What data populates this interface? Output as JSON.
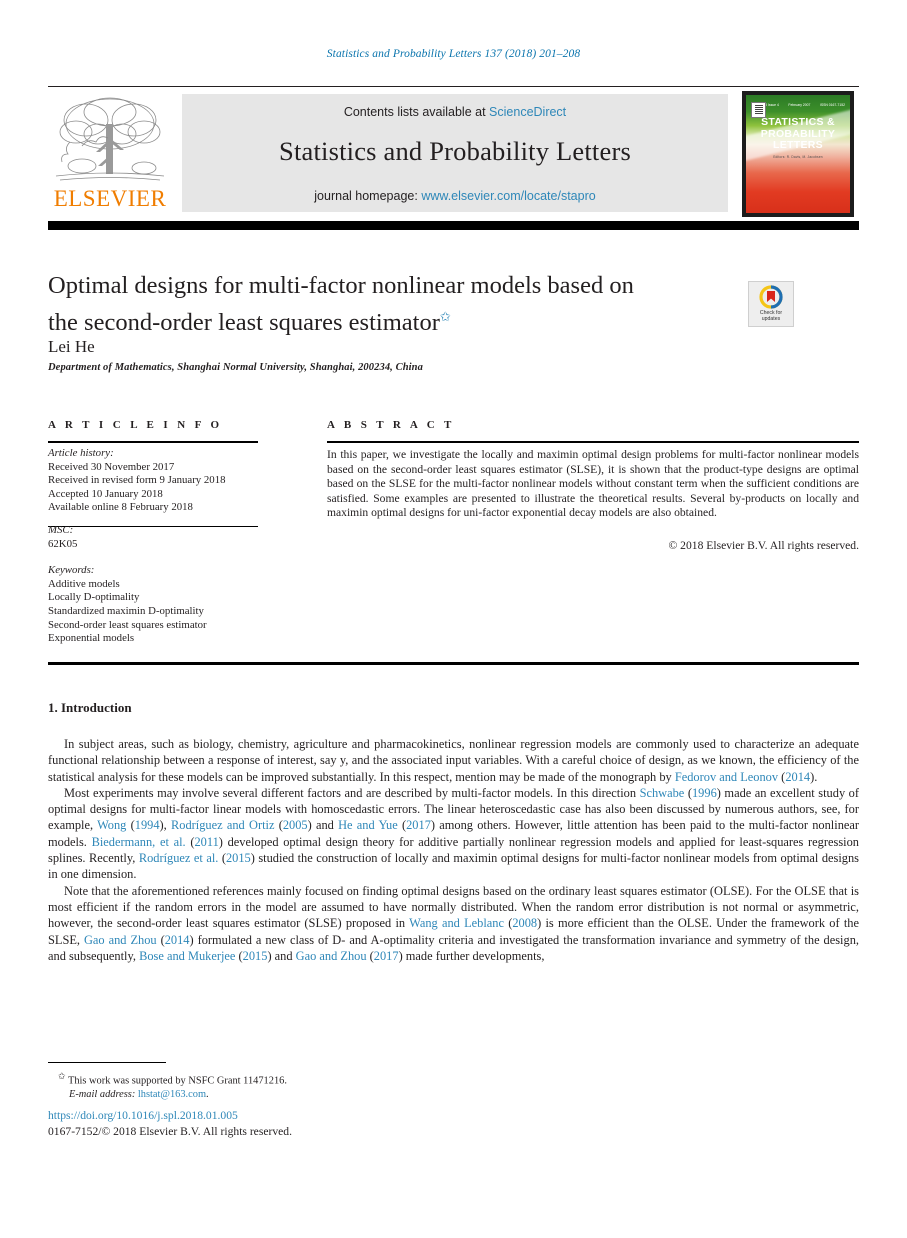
{
  "running_head": "Statistics and Probability Letters 137 (2018) 201–208",
  "masthead": {
    "contents_prefix": "Contents lists available at",
    "contents_link": "ScienceDirect",
    "journal_name": "Statistics and Probability Letters",
    "homepage_prefix": "journal homepage:",
    "homepage_link": "www.elsevier.com/locate/stapro",
    "publisher_wordmark": "ELSEVIER",
    "cover": {
      "title_line1": "STATISTICS &",
      "title_line2": "PROBABILITY",
      "title_line3": "LETTERS",
      "top_left": "Volume 73 Issue 4",
      "top_mid": "February 2007",
      "top_right": "ISSN 0167-7152",
      "subtext": "Editors: R. Davis, M. Jacobsen"
    }
  },
  "article": {
    "title_line1": "Optimal designs for multi-factor nonlinear models based on",
    "title_line2": "the second-order least squares estimator",
    "title_footnote_mark": "✩",
    "author": "Lei He",
    "affiliation": "Department of Mathematics, Shanghai Normal University, Shanghai, 200234, China",
    "crossmark": {
      "line1": "Check for",
      "line2": "updates"
    }
  },
  "info": {
    "heading": "A R T I C L E   I N F O",
    "history_label": "Article history:",
    "history": [
      "Received 30 November 2017",
      "Received in revised form 9 January 2018",
      "Accepted 10 January 2018",
      "Available online 8 February 2018"
    ],
    "msc_label": "MSC:",
    "msc_values": [
      "62K05"
    ],
    "keywords_label": "Keywords:",
    "keywords": [
      "Additive models",
      "Locally D-optimality",
      "Standardized maximin D-optimality",
      "Second-order least squares estimator",
      "Exponential models"
    ]
  },
  "abstract": {
    "heading": "A B S T R A C T",
    "body": "In this paper, we investigate the locally and maximin optimal design problems for multi-factor nonlinear models based on the second-order least squares estimator (SLSE), it is shown that the product-type designs are optimal based on the SLSE for the multi-factor nonlinear models without constant term when the sufficient conditions are satisfied. Some examples are presented to illustrate the theoretical results. Several by-products on locally and maximin optimal designs for uni-factor exponential decay models are also obtained.",
    "copyright": "© 2018 Elsevier B.V. All rights reserved."
  },
  "section": {
    "number_title": "1. Introduction"
  },
  "paragraphs": {
    "p1": {
      "a": "In subject areas, such as biology, chemistry, agriculture and pharmacokinetics, nonlinear regression models are commonly used to characterize an adequate functional relationship between a response of interest, say y, and the associated input variables. With a careful choice of design, as we known, the efficiency of the statistical analysis for these models can be improved substantially. In this respect, mention may be made of the monograph by ",
      "ref1": "Fedorov and Leonov",
      "mid1": " (",
      "year1": "2014",
      "tail": ")."
    },
    "p2_parts": [
      {
        "t": "Most experiments may involve several different factors and are described by multi-factor models. In this direction ",
        "k": "text"
      },
      {
        "t": "Schwabe",
        "k": "link"
      },
      {
        "t": " (",
        "k": "text"
      },
      {
        "t": "1996",
        "k": "link"
      },
      {
        "t": ") made an excellent study of optimal designs for multi-factor linear models with homoscedastic errors. The linear heteroscedastic case has also been discussed by numerous authors, see, for example, ",
        "k": "text"
      },
      {
        "t": "Wong",
        "k": "link"
      },
      {
        "t": " (",
        "k": "text"
      },
      {
        "t": "1994",
        "k": "link"
      },
      {
        "t": "), ",
        "k": "text"
      },
      {
        "t": "Rodríguez and Ortiz",
        "k": "link"
      },
      {
        "t": " (",
        "k": "text"
      },
      {
        "t": "2005",
        "k": "link"
      },
      {
        "t": ") and ",
        "k": "text"
      },
      {
        "t": "He and Yue",
        "k": "link"
      },
      {
        "t": " (",
        "k": "text"
      },
      {
        "t": "2017",
        "k": "link"
      },
      {
        "t": ") among others. However, little attention has been paid to the multi-factor nonlinear models. ",
        "k": "text"
      },
      {
        "t": "Biedermann, et al.",
        "k": "link"
      },
      {
        "t": " (",
        "k": "text"
      },
      {
        "t": "2011",
        "k": "link"
      },
      {
        "t": ") developed optimal design theory for additive partially nonlinear regression models and applied for least-squares regression splines. Recently, ",
        "k": "text"
      },
      {
        "t": "Rodríguez et al.",
        "k": "link"
      },
      {
        "t": " (",
        "k": "text"
      },
      {
        "t": "2015",
        "k": "link"
      },
      {
        "t": ") studied the construction of locally and maximin optimal designs for multi-factor nonlinear models from optimal designs in one dimension.",
        "k": "text"
      }
    ],
    "p3_parts": [
      {
        "t": "Note that the aforementioned references mainly focused on finding optimal designs based on the ordinary least squares estimator (OLSE). For the OLSE that is most efficient if the random errors in the model are assumed to have normally distributed. When the random error distribution is not normal or asymmetric, however, the second-order least squares estimator (SLSE) proposed in ",
        "k": "text"
      },
      {
        "t": "Wang and Leblanc",
        "k": "link"
      },
      {
        "t": " (",
        "k": "text"
      },
      {
        "t": "2008",
        "k": "link"
      },
      {
        "t": ") is more efficient than the OLSE. Under the framework of the SLSE, ",
        "k": "text"
      },
      {
        "t": "Gao and Zhou",
        "k": "link"
      },
      {
        "t": " (",
        "k": "text"
      },
      {
        "t": "2014",
        "k": "link"
      },
      {
        "t": ") formulated a new class of D- and A-optimality criteria and investigated the transformation invariance and symmetry of the design, and subsequently, ",
        "k": "text"
      },
      {
        "t": "Bose and Mukerjee",
        "k": "link"
      },
      {
        "t": " (",
        "k": "text"
      },
      {
        "t": "2015",
        "k": "link"
      },
      {
        "t": ") and ",
        "k": "text"
      },
      {
        "t": "Gao and Zhou",
        "k": "link"
      },
      {
        "t": " (",
        "k": "text"
      },
      {
        "t": "2017",
        "k": "link"
      },
      {
        "t": ") made further developments,",
        "k": "text"
      }
    ]
  },
  "footer": {
    "footnote_mark": "✩",
    "footnote_text": "This work was supported by NSFC Grant 11471216.",
    "email_label": "E-mail address:",
    "email": "lhstat@163.com",
    "email_tail": ".",
    "doi": "https://doi.org/10.1016/j.spl.2018.01.005",
    "issn": "0167-7152/© 2018 Elsevier B.V. All rights reserved."
  },
  "colors": {
    "link_blue": "#2e87b8",
    "running_head_blue": "#0a74ad",
    "elsevier_orange": "#f07d00",
    "rule_black": "#000000"
  }
}
